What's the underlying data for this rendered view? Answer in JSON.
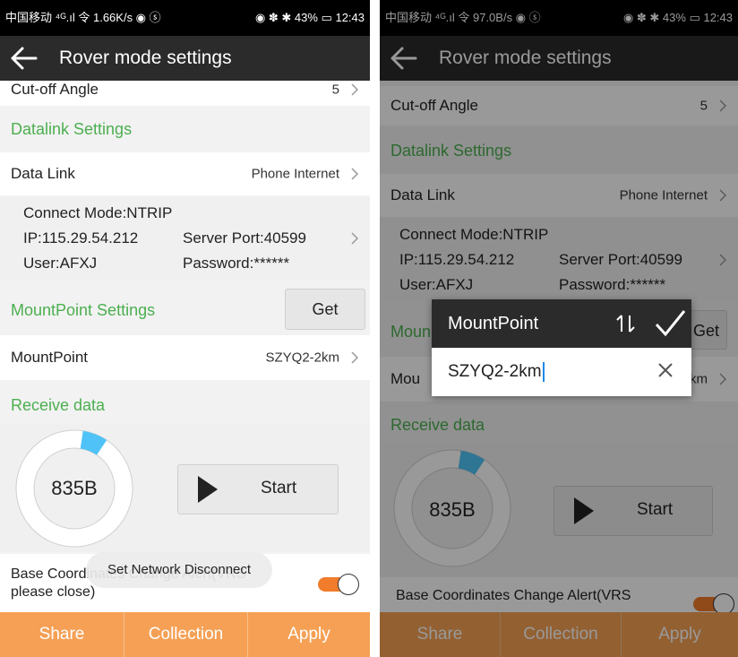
{
  "left": {
    "status": {
      "left": "中国移动 ⁴ᴳ.ıl 令 1.66K/s ◉ ⓢ",
      "right": "◉ ✽ ✱ 43% ▭ 12:43"
    },
    "title": "Rover mode settings",
    "cutoff": {
      "label": "Cut-off Angle",
      "value": "5"
    },
    "datalink_section": "Datalink Settings",
    "datalink": {
      "label": "Data Link",
      "value": "Phone Internet"
    },
    "conn": {
      "mode": "Connect Mode:NTRIP",
      "ip": "IP:115.29.54.212",
      "port": "Server Port:40599",
      "user": "User:AFXJ",
      "password": "Password:******"
    },
    "mount_section": "MountPoint Settings",
    "get_label": "Get",
    "mountpoint": {
      "label": "MountPoint",
      "value": "SZYQ2-2km"
    },
    "receive_section": "Receive data",
    "gauge_value": "835B",
    "gauge_fraction": 0.07,
    "start_label": "Start",
    "alert_line1": "Base Coordinates Change Alert(VRS",
    "alert_line2": "please close)",
    "toast": "Set Network Disconnect",
    "bottom": {
      "share": "Share",
      "collection": "Collection",
      "apply": "Apply"
    }
  },
  "right": {
    "status": {
      "left": "中国移动 ⁴ᴳ.ıl 令 97.0B/s ◉ ⓢ",
      "right": "◉ ✽ ✱ 43% ▭ 12:43"
    },
    "title": "Rover mode settings",
    "cutoff": {
      "label": "Cut-off Angle",
      "value": "5"
    },
    "datalink_section": "Datalink Settings",
    "datalink": {
      "label": "Data Link",
      "value": "Phone Internet"
    },
    "conn": {
      "mode": "Connect Mode:NTRIP",
      "ip": "IP:115.29.54.212",
      "port": "Server Port:40599",
      "user": "User:AFXJ",
      "password": "Password:******"
    },
    "mount_section": "Moun",
    "get_label": "Get",
    "mountpoint": {
      "label": "Mou",
      "value": "km"
    },
    "receive_section": "Receive data",
    "gauge_value": "835B",
    "gauge_fraction": 0.07,
    "start_label": "Start",
    "alert_line1": "Base Coordinates Change Alert(VRS",
    "bottom": {
      "share": "Share",
      "collection": "Collection",
      "apply": "Apply"
    },
    "dialog": {
      "title": "MountPoint",
      "input_value": "SZYQ2-2km"
    }
  },
  "colors": {
    "accent": "#4caf50",
    "toggle": "#f07c2c",
    "bottom_bar": "#f5a054",
    "header": "#2b2b2b",
    "gauge_fill": "#4fc3f7"
  },
  "icons": [
    "back-arrow-icon",
    "chevron-right-icon",
    "play-icon",
    "sort-icon",
    "check-icon",
    "close-icon"
  ]
}
